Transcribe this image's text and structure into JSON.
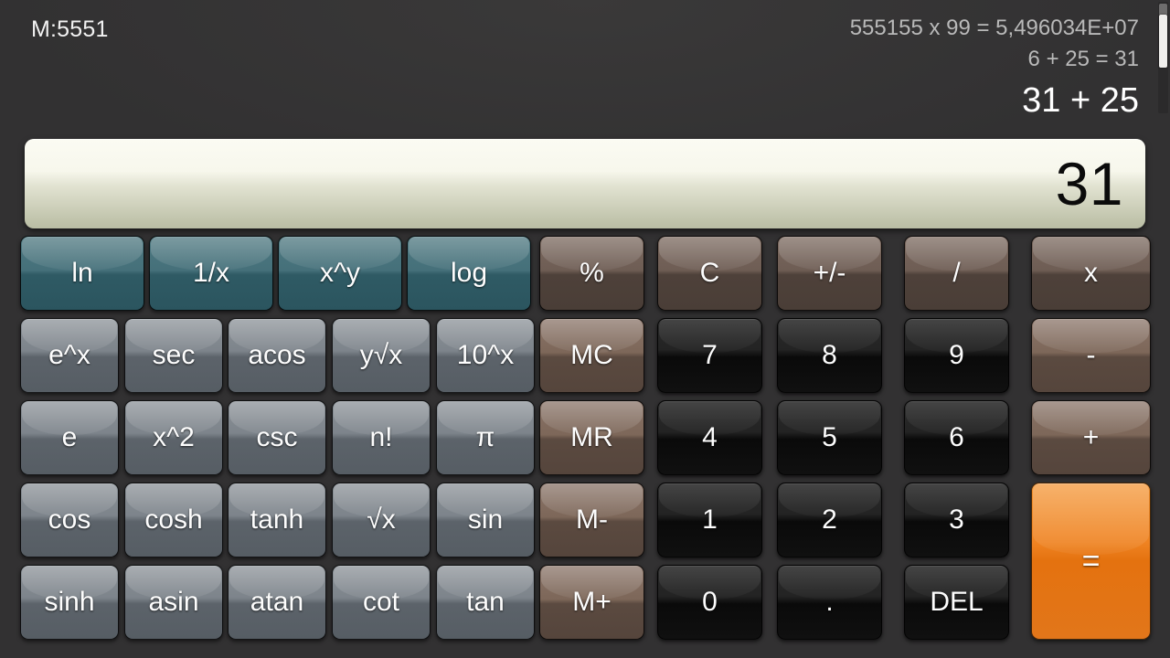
{
  "memory": {
    "label": "M:5551"
  },
  "history": {
    "lines": [
      "555155 x 99 = 5,496034E+07",
      "6 + 25 = 31"
    ],
    "current_expression": "31 + 25"
  },
  "display": {
    "value": "31"
  },
  "colors": {
    "background": "#333233",
    "teal_key": "#45707a",
    "brown_key": "#6e5d54",
    "memory_key": "#7d6759",
    "sci_key": "#7d848b",
    "number_key": "#1a1a1a",
    "equals_key": "#e8761a",
    "display_top": "#fbfbf3",
    "display_bottom": "#b9bda4"
  },
  "keypad": {
    "row1": [
      {
        "label": "ln",
        "style": "teal"
      },
      {
        "label": "1/x",
        "style": "teal"
      },
      {
        "label": "x^y",
        "style": "teal"
      },
      {
        "label": "log",
        "style": "teal"
      },
      {
        "label": "%",
        "style": "brown"
      },
      {
        "label": "C",
        "style": "brown"
      },
      {
        "label": "+/-",
        "style": "brown"
      },
      {
        "label": "/",
        "style": "brown"
      },
      {
        "label": "x",
        "style": "brown"
      }
    ],
    "row2": [
      {
        "label": "e^x",
        "style": "sci"
      },
      {
        "label": "sec",
        "style": "sci"
      },
      {
        "label": "acos",
        "style": "sci"
      },
      {
        "label": "y√x",
        "style": "sci"
      },
      {
        "label": "10^x",
        "style": "sci"
      },
      {
        "label": "MC",
        "style": "mem"
      },
      {
        "label": "7",
        "style": "num"
      },
      {
        "label": "8",
        "style": "num"
      },
      {
        "label": "9",
        "style": "num"
      },
      {
        "label": "-",
        "style": "mem"
      }
    ],
    "row3": [
      {
        "label": "e",
        "style": "sci"
      },
      {
        "label": "x^2",
        "style": "sci"
      },
      {
        "label": "csc",
        "style": "sci"
      },
      {
        "label": "n!",
        "style": "sci"
      },
      {
        "label": "π",
        "style": "sci"
      },
      {
        "label": "MR",
        "style": "mem"
      },
      {
        "label": "4",
        "style": "num"
      },
      {
        "label": "5",
        "style": "num"
      },
      {
        "label": "6",
        "style": "num"
      },
      {
        "label": "+",
        "style": "mem"
      }
    ],
    "row4": [
      {
        "label": "cos",
        "style": "sci"
      },
      {
        "label": "cosh",
        "style": "sci"
      },
      {
        "label": "tanh",
        "style": "sci"
      },
      {
        "label": "√x",
        "style": "sci"
      },
      {
        "label": "sin",
        "style": "sci"
      },
      {
        "label": "M-",
        "style": "mem"
      },
      {
        "label": "1",
        "style": "num"
      },
      {
        "label": "2",
        "style": "num"
      },
      {
        "label": "3",
        "style": "num"
      },
      {
        "label": "=",
        "style": "eq",
        "tall": true
      }
    ],
    "row5": [
      {
        "label": "sinh",
        "style": "sci"
      },
      {
        "label": "asin",
        "style": "sci"
      },
      {
        "label": "atan",
        "style": "sci"
      },
      {
        "label": "cot",
        "style": "sci"
      },
      {
        "label": "tan",
        "style": "sci"
      },
      {
        "label": "M+",
        "style": "mem"
      },
      {
        "label": "0",
        "style": "num"
      },
      {
        "label": ".",
        "style": "num"
      },
      {
        "label": "DEL",
        "style": "num"
      }
    ]
  }
}
